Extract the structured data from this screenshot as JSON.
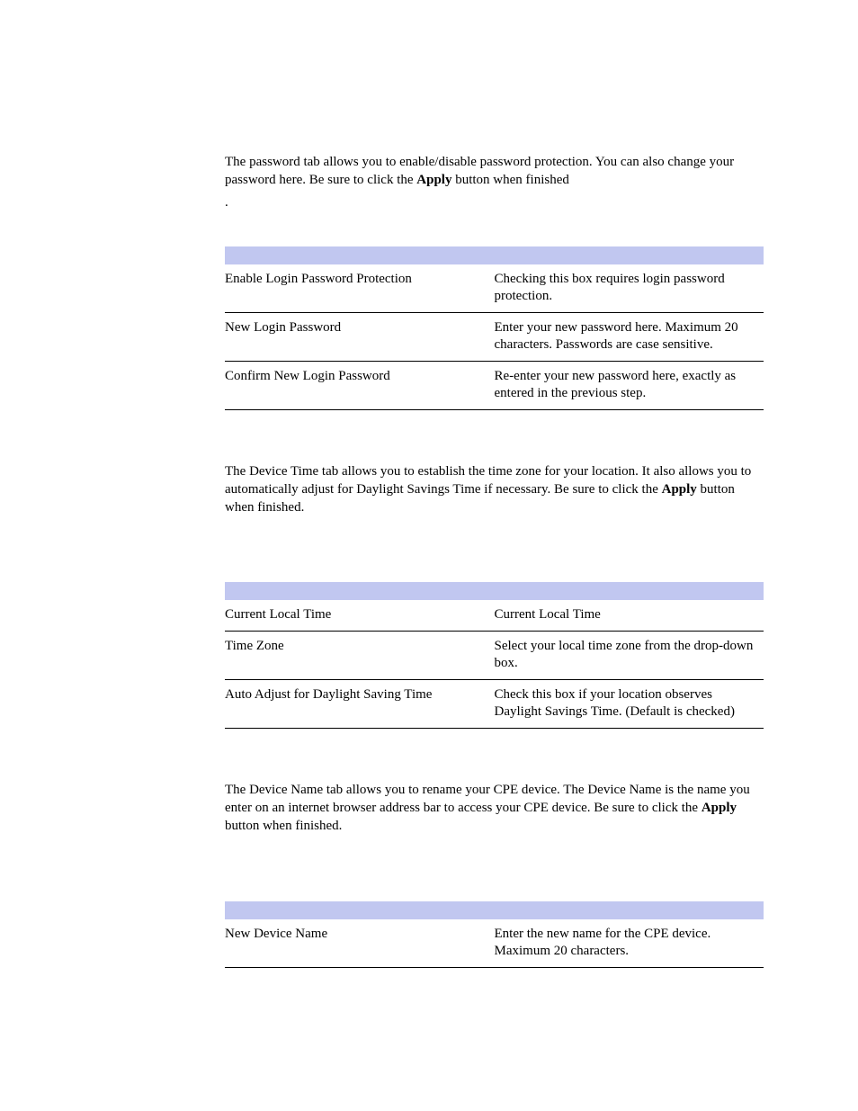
{
  "password_section": {
    "intro_before": "The password tab allows you to enable/disable password protection. You can also change your password here. Be sure to click the ",
    "intro_bold": "Apply",
    "intro_after": " button when finished",
    "dot": ".",
    "rows": [
      {
        "field": "Enable Login Password Protection",
        "desc": "Checking this box requires login password protection."
      },
      {
        "field": "New Login Password",
        "desc": "Enter your new password here. Maximum 20 characters. Passwords are case sensitive."
      },
      {
        "field": "Confirm New Login Password",
        "desc": "Re-enter your new password here, exactly as entered in the previous step."
      }
    ]
  },
  "device_time_section": {
    "intro_before": "The Device Time tab allows you to establish the time zone for your location. It also allows you to automatically adjust for Daylight Savings Time if necessary. Be sure to click the ",
    "intro_bold": "Apply",
    "intro_after": " button when finished.",
    "rows": [
      {
        "field": "Current Local Time",
        "desc": "Current Local Time"
      },
      {
        "field": "Time Zone",
        "desc": "Select your local time zone from the drop-down box."
      },
      {
        "field": "Auto Adjust for Daylight Saving Time",
        "desc": "Check this box if your location observes Daylight Savings Time. (Default is checked)"
      }
    ]
  },
  "device_name_section": {
    "intro_before": "The Device Name tab allows you to rename your CPE device. The Device Name is the name you enter on an internet browser address bar to access your CPE device. Be sure to click the ",
    "intro_bold": "Apply",
    "intro_after": " button when finished.",
    "rows": [
      {
        "field": "New Device Name",
        "desc": "Enter the new name for the CPE device. Maximum 20 characters."
      }
    ]
  }
}
